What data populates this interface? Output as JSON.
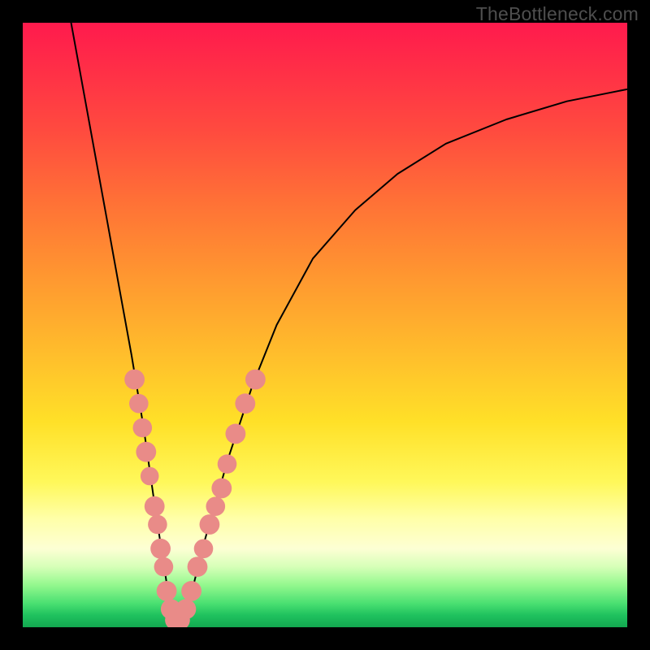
{
  "watermark": "TheBottleneck.com",
  "chart_data": {
    "type": "line",
    "title": "",
    "xlabel": "",
    "ylabel": "",
    "xlim": [
      0,
      100
    ],
    "ylim": [
      0,
      100
    ],
    "grid": false,
    "series": [
      {
        "name": "bottleneck-curve",
        "x": [
          8,
          10,
          12,
          14,
          16,
          18,
          20,
          22,
          24,
          25,
          26,
          28,
          30,
          34,
          38,
          42,
          48,
          55,
          62,
          70,
          80,
          90,
          100
        ],
        "y": [
          100,
          89,
          78,
          67,
          56,
          45,
          33,
          19,
          6,
          1,
          1,
          6,
          14,
          28,
          40,
          50,
          61,
          69,
          75,
          80,
          84,
          87,
          89
        ]
      }
    ],
    "markers": [
      {
        "x": 18.5,
        "y": 41,
        "r": 1.5
      },
      {
        "x": 19.2,
        "y": 37,
        "r": 1.4
      },
      {
        "x": 19.8,
        "y": 33,
        "r": 1.4
      },
      {
        "x": 20.4,
        "y": 29,
        "r": 1.5
      },
      {
        "x": 21.0,
        "y": 25,
        "r": 1.3
      },
      {
        "x": 21.8,
        "y": 20,
        "r": 1.5
      },
      {
        "x": 22.3,
        "y": 17,
        "r": 1.4
      },
      {
        "x": 22.8,
        "y": 13,
        "r": 1.5
      },
      {
        "x": 23.3,
        "y": 10,
        "r": 1.4
      },
      {
        "x": 23.8,
        "y": 6,
        "r": 1.5
      },
      {
        "x": 24.5,
        "y": 3,
        "r": 1.5
      },
      {
        "x": 25.2,
        "y": 1.2,
        "r": 1.5
      },
      {
        "x": 26.0,
        "y": 1.2,
        "r": 1.5
      },
      {
        "x": 27.0,
        "y": 3,
        "r": 1.5
      },
      {
        "x": 27.9,
        "y": 6,
        "r": 1.5
      },
      {
        "x": 28.9,
        "y": 10,
        "r": 1.5
      },
      {
        "x": 29.9,
        "y": 13,
        "r": 1.4
      },
      {
        "x": 30.9,
        "y": 17,
        "r": 1.5
      },
      {
        "x": 31.9,
        "y": 20,
        "r": 1.4
      },
      {
        "x": 32.9,
        "y": 23,
        "r": 1.5
      },
      {
        "x": 33.8,
        "y": 27,
        "r": 1.4
      },
      {
        "x": 35.2,
        "y": 32,
        "r": 1.5
      },
      {
        "x": 36.8,
        "y": 37,
        "r": 1.5
      },
      {
        "x": 38.5,
        "y": 41,
        "r": 1.5
      }
    ],
    "colors": {
      "curve": "#000000",
      "marker_fill": "#e98b88",
      "marker_stroke": "#6b2a28"
    }
  }
}
